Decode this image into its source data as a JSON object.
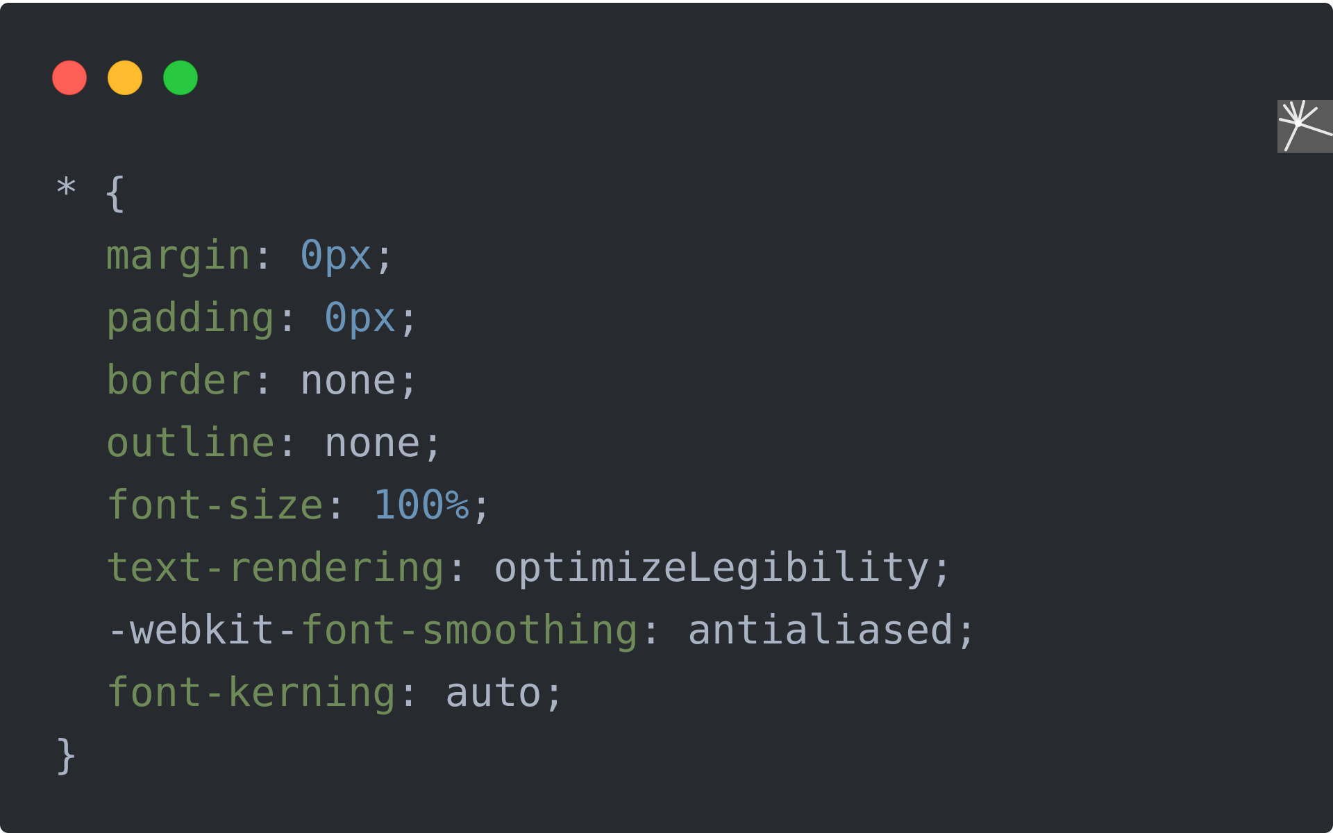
{
  "window": {
    "controls": {
      "close_color": "#fe5f57",
      "minimize_color": "#febc2e",
      "maximize_color": "#28c840"
    }
  },
  "colors": {
    "background": "#272a2e",
    "property": "#6f8a59",
    "number": "#6a93b8",
    "text": "#a9b3c4"
  },
  "code": {
    "selector": "*",
    "open_brace": "{",
    "close_brace": "}",
    "declarations": [
      {
        "prefix": "",
        "property": "margin",
        "value": "0px",
        "value_kind": "number"
      },
      {
        "prefix": "",
        "property": "padding",
        "value": "0px",
        "value_kind": "number"
      },
      {
        "prefix": "",
        "property": "border",
        "value": "none",
        "value_kind": "keyword"
      },
      {
        "prefix": "",
        "property": "outline",
        "value": "none",
        "value_kind": "keyword"
      },
      {
        "prefix": "",
        "property": "font-size",
        "value": "100%",
        "value_kind": "number"
      },
      {
        "prefix": "",
        "property": "text-rendering",
        "value": "optimizeLegibility",
        "value_kind": "keyword"
      },
      {
        "prefix": "-webkit-",
        "property": "font-smoothing",
        "value": "antialiased",
        "value_kind": "keyword"
      },
      {
        "prefix": "",
        "property": "font-kerning",
        "value": "auto",
        "value_kind": "keyword"
      }
    ]
  }
}
